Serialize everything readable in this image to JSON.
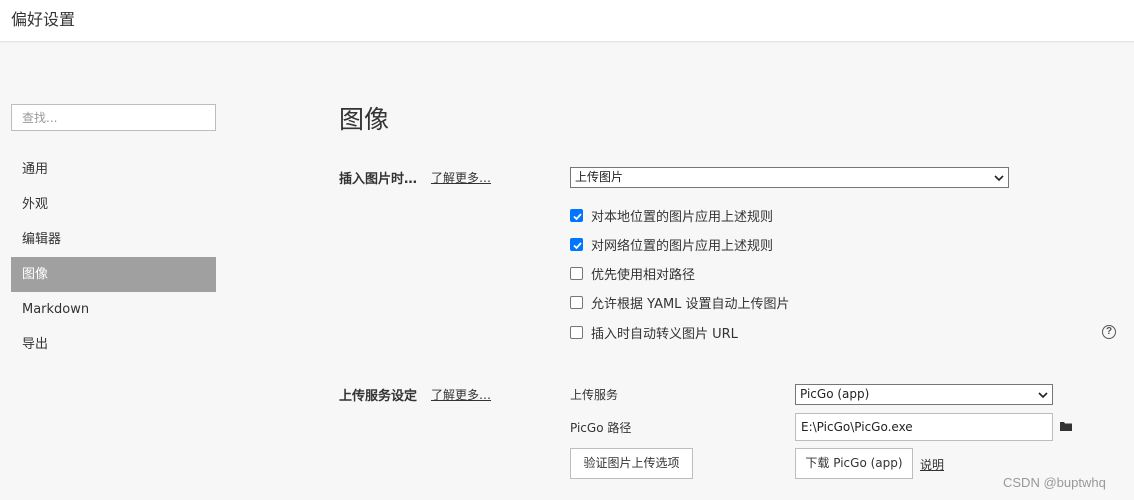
{
  "window": {
    "title": "偏好设置"
  },
  "search": {
    "placeholder": "查找..."
  },
  "sidebar": {
    "items": [
      {
        "label": "通用"
      },
      {
        "label": "外观"
      },
      {
        "label": "编辑器"
      },
      {
        "label": "图像",
        "active": true
      },
      {
        "label": "Markdown"
      },
      {
        "label": "导出"
      }
    ]
  },
  "main": {
    "title": "图像",
    "insert_section": {
      "label": "插入图片时…",
      "learn_more": "了解更多…",
      "select_value": "上传图片",
      "options": [
        {
          "label": "对本地位置的图片应用上述规则",
          "checked": true
        },
        {
          "label": "对网络位置的图片应用上述规则",
          "checked": true
        },
        {
          "label": "优先使用相对路径",
          "checked": false
        },
        {
          "label": "允许根据 YAML 设置自动上传图片",
          "checked": false
        },
        {
          "label": "插入时自动转义图片 URL",
          "checked": false
        }
      ],
      "help_icon": "?"
    },
    "upload_section": {
      "label": "上传服务设定",
      "learn_more": "了解更多…",
      "service_label": "上传服务",
      "service_value": "PicGo (app)",
      "path_label": "PicGo 路径",
      "path_value": "E:\\PicGo\\PicGo.exe",
      "verify_button": "验证图片上传选项",
      "download_button": "下载 PicGo (app)",
      "explain_link": "说明"
    }
  },
  "watermark": "CSDN @buptwhq",
  "colors": {
    "accent": "#0075ff",
    "active_nav": "#a0a0a0",
    "background": "#f7f7f7"
  }
}
